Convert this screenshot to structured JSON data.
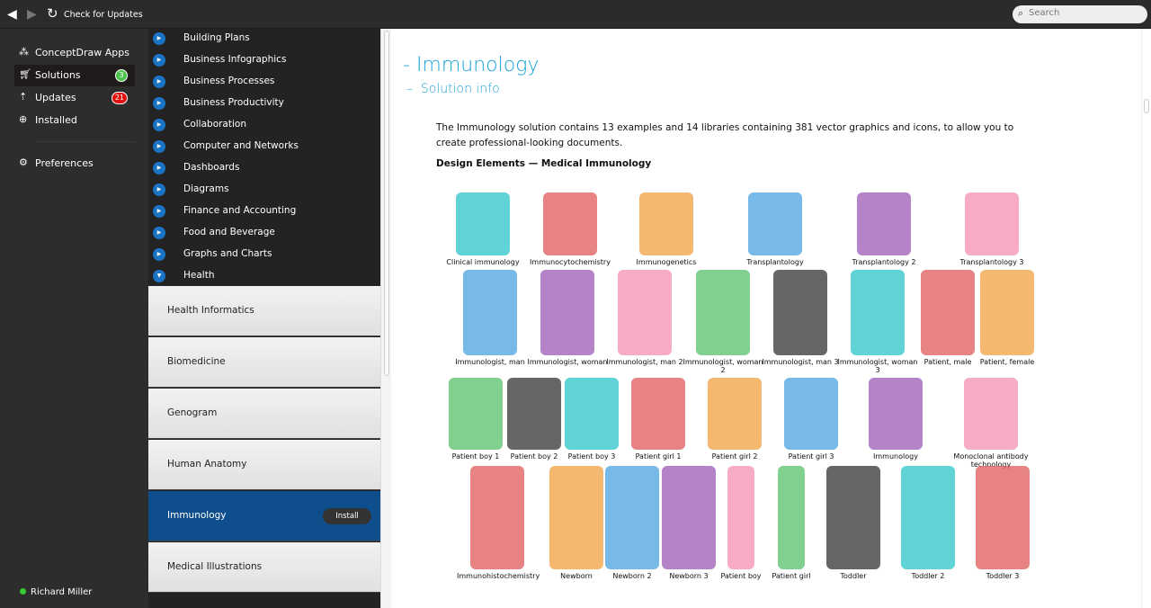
{
  "toolbar": {
    "check_updates": "Check for Updates",
    "search_placeholder": "Search"
  },
  "left_nav": [
    {
      "label": "ConceptDraw Apps",
      "icon": "apps-icon"
    },
    {
      "label": "Solutions",
      "icon": "cart-icon",
      "badge": "3",
      "badge_color": "#4cc34c",
      "active": true
    },
    {
      "label": "Updates",
      "icon": "updates-icon",
      "badge": "21",
      "badge_color": "#e01010"
    },
    {
      "label": "Installed",
      "icon": "download-icon"
    },
    {
      "label": "Preferences",
      "icon": "gear-icon"
    }
  ],
  "user": {
    "name": "Richard Miller",
    "status_color": "#33cc33"
  },
  "categories": [
    "Building Plans",
    "Business Infographics",
    "Business Processes",
    "Business Productivity",
    "Collaboration",
    "Computer and Networks",
    "Dashboards",
    "Diagrams",
    "Finance and Accounting",
    "Food and Beverage",
    "Graphs and Charts",
    "Health"
  ],
  "solutions": [
    {
      "label": "Health Informatics"
    },
    {
      "label": "Biomedicine"
    },
    {
      "label": "Genogram"
    },
    {
      "label": "Human Anatomy"
    },
    {
      "label": "Immunology",
      "selected": true,
      "button": "Install"
    },
    {
      "label": "Medical Illustrations"
    }
  ],
  "content": {
    "title": "Immunology",
    "subtitle": "Solution info",
    "description": "The Immunology solution contains 13 examples and 14 libraries containing 381 vector graphics and icons, to allow you to create professional-looking documents.",
    "section_heading": "Design Elements — Medical Immunology",
    "elements": [
      [
        "Clinical immunology",
        "Immunocytochemistry",
        "Immunogenetics",
        "Transplantology",
        "Transplantology 2",
        "Transplantology 3"
      ],
      [
        "Immunologist, man",
        "Immunologist, woman",
        "Immunologist, man 2",
        "Immunologist, woman 2",
        "Immunologist, man 3",
        "Immunologist, woman 3",
        "Patient, male",
        "Patient, female"
      ],
      [
        "Patient boy 1",
        "Patient boy 2",
        "Patient boy 3",
        "Patient girl 1",
        "Patient girl 2",
        "Patient girl 3",
        "Immunology",
        "Monoclonal antibody technology"
      ],
      [
        "Immunohistochemistry",
        "Newborn",
        "Newborn 2",
        "Newborn 3",
        "Patient boy",
        "Patient girl",
        "Toddler",
        "Toddler 2",
        "Toddler 3"
      ]
    ]
  }
}
